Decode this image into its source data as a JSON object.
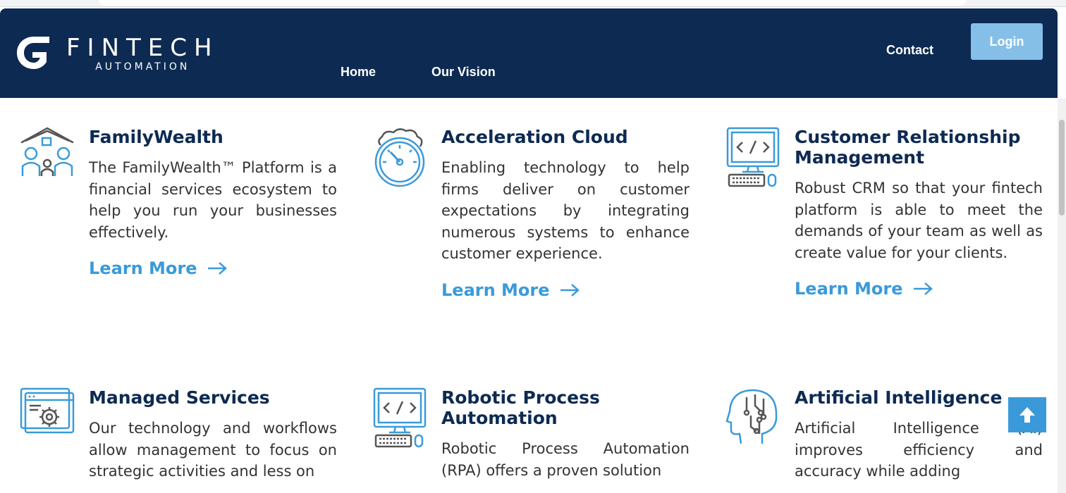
{
  "header": {
    "logo_name": "FINTECH",
    "logo_sub": "AUTOMATION",
    "nav": {
      "home": "Home",
      "vision": "Our Vision",
      "contact": "Contact"
    },
    "login_label": "Login"
  },
  "cards": [
    {
      "title": "FamilyWealth",
      "text": "The FamilyWealth™ Platform is a financial services ecosystem to help you run your businesses effectively.",
      "link": "Learn More",
      "icon": "family-house-icon"
    },
    {
      "title": "Acceleration Cloud",
      "text": "Enabling technology to help firms deliver on customer expectations by integrating numerous systems to enhance customer experience.",
      "link": "Learn More",
      "icon": "cloud-gauge-icon"
    },
    {
      "title": "Customer Relationship Management",
      "text": "Robust CRM so that your fintech platform is able to meet the demands of your team as well as create value for your clients.",
      "link": "Learn More",
      "icon": "computer-code-icon"
    },
    {
      "title": "Managed Services",
      "text": "Our technology and workflows allow management to focus on strategic activities and less on",
      "icon": "browser-gear-icon"
    },
    {
      "title": "Robotic Process Automation",
      "text": "Robotic Process Automation (RPA) offers a proven solution",
      "icon": "computer-code-icon"
    },
    {
      "title": "Artificial Intelligence",
      "text": "Artificial Intelligence (AI) improves efficiency and accuracy while adding",
      "icon": "ai-head-icon"
    }
  ],
  "colors": {
    "navy": "#0d2a52",
    "accent": "#3a9ad9",
    "login": "#85bfe8"
  }
}
